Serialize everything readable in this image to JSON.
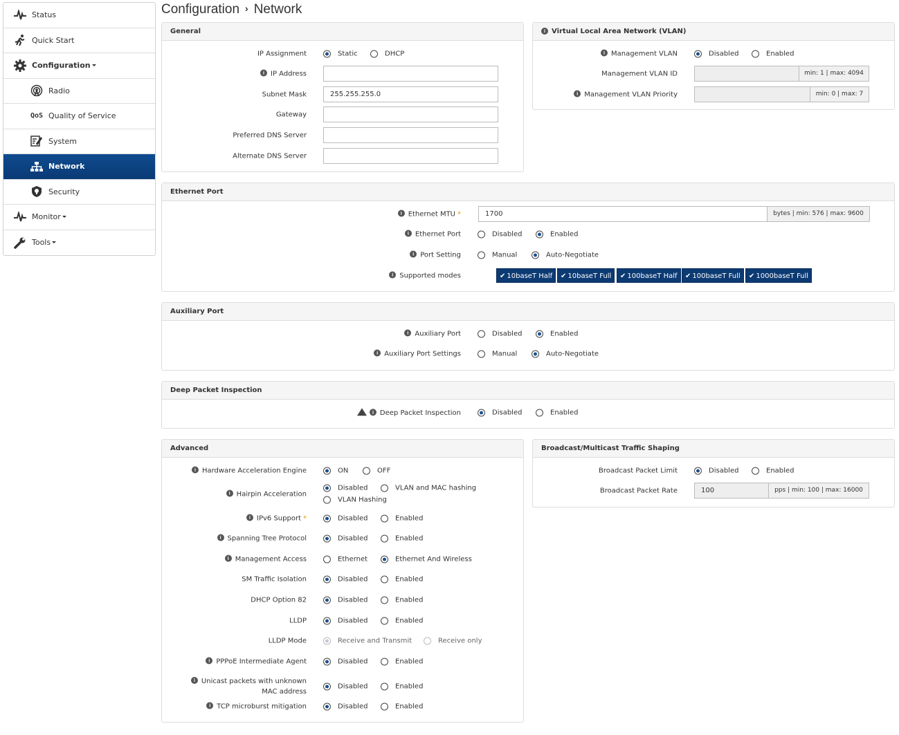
{
  "nav": {
    "status": "Status",
    "quick_start": "Quick Start",
    "configuration": "Configuration",
    "radio": "Radio",
    "qos": "Quality of Service",
    "system": "System",
    "network": "Network",
    "security": "Security",
    "monitor": "Monitor",
    "tools": "Tools"
  },
  "breadcrumb": {
    "section": "Configuration",
    "page": "Network",
    "separator": "›"
  },
  "general": {
    "title": "General",
    "ip_assignment": "IP Assignment",
    "static": "Static",
    "dhcp": "DHCP",
    "ip_address": "IP Address",
    "ip_address_value": "",
    "subnet_mask": "Subnet Mask",
    "subnet_mask_value": "255.255.255.0",
    "gateway": "Gateway",
    "gateway_value": "",
    "preferred_dns": "Preferred DNS Server",
    "preferred_dns_value": "",
    "alternate_dns": "Alternate DNS Server",
    "alternate_dns_value": ""
  },
  "vlan": {
    "title": "Virtual Local Area Network (VLAN)",
    "management_vlan": "Management VLAN",
    "disabled": "Disabled",
    "enabled": "Enabled",
    "vlan_id": "Management VLAN ID",
    "vlan_id_range": "min: 1 | max: 4094",
    "vlan_priority": "Management VLAN Priority",
    "vlan_priority_range": "min: 0 | max: 7"
  },
  "ethernet": {
    "title": "Ethernet Port",
    "mtu": "Ethernet MTU",
    "mtu_value": "1700",
    "mtu_range": "bytes | min: 576 | max: 9600",
    "port": "Ethernet Port",
    "disabled": "Disabled",
    "enabled": "Enabled",
    "port_setting": "Port Setting",
    "manual": "Manual",
    "auto": "Auto-Negotiate",
    "supported_modes": "Supported modes",
    "modes": [
      "10baseT Half",
      "10baseT Full",
      "100baseT Half",
      "100baseT Full",
      "1000baseT Full"
    ]
  },
  "aux": {
    "title": "Auxiliary Port",
    "port": "Auxiliary Port",
    "disabled": "Disabled",
    "enabled": "Enabled",
    "settings": "Auxiliary Port Settings",
    "manual": "Manual",
    "auto": "Auto-Negotiate"
  },
  "dpi": {
    "title": "Deep Packet Inspection",
    "label": "Deep Packet Inspection",
    "disabled": "Disabled",
    "enabled": "Enabled"
  },
  "advanced": {
    "title": "Advanced",
    "hae": "Hardware Acceleration Engine",
    "on": "ON",
    "off": "OFF",
    "hairpin": "Hairpin Acceleration",
    "disabled": "Disabled",
    "vlan_mac": "VLAN and MAC hashing",
    "vlan_hashing": "VLAN Hashing",
    "ipv6": "IPv6 Support",
    "enabled": "Enabled",
    "stp": "Spanning Tree Protocol",
    "mgmt_access": "Management Access",
    "ethernet": "Ethernet",
    "eth_wireless": "Ethernet And Wireless",
    "sm_isolation": "SM Traffic Isolation",
    "dhcp82": "DHCP Option 82",
    "lldp": "LLDP",
    "lldp_mode": "LLDP Mode",
    "rx_tx": "Receive and Transmit",
    "rx_only": "Receive only",
    "pppoe": "PPPoE Intermediate Agent",
    "unicast_1": "Unicast packets with unknown",
    "unicast_2": "MAC address",
    "tcp": "TCP microburst mitigation"
  },
  "broadcast": {
    "title": "Broadcast/Multicast Traffic Shaping",
    "limit": "Broadcast Packet Limit",
    "disabled": "Disabled",
    "enabled": "Enabled",
    "rate": "Broadcast Packet Rate",
    "rate_value": "100",
    "rate_range": "pps | min: 100 | max: 16000"
  },
  "icons": {
    "info": "i"
  },
  "colors": {
    "accent": "#0c3a73",
    "active_nav": "#0f4b8f",
    "required": "#e69c00"
  }
}
